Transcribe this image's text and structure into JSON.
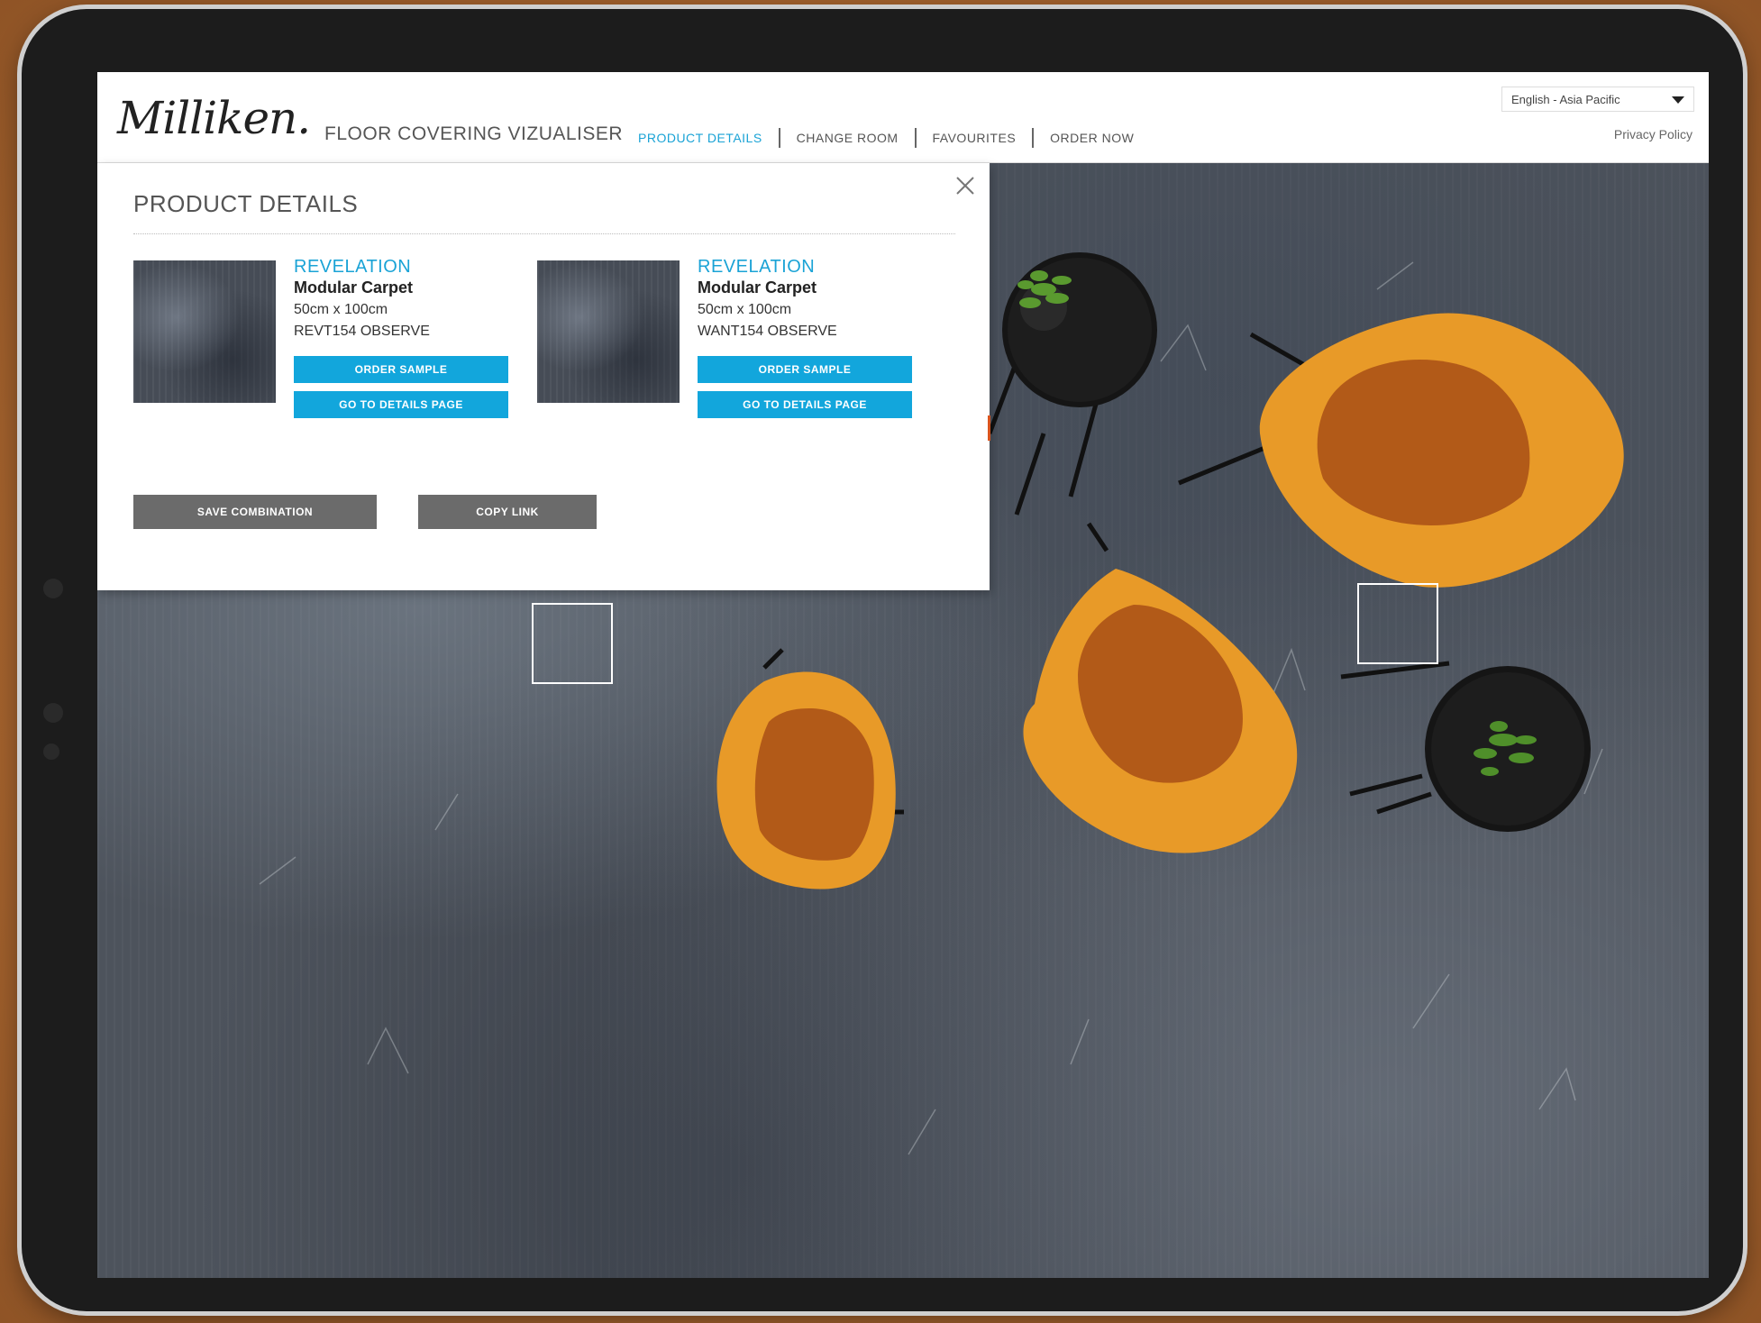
{
  "header": {
    "logo_text": "Milliken.",
    "app_title": "FLOOR COVERING VIZUALISER",
    "nav": [
      "PRODUCT DETAILS",
      "CHANGE ROOM",
      "FAVOURITES",
      "ORDER NOW"
    ],
    "active_nav": "PRODUCT DETAILS",
    "language": "English - Asia Pacific",
    "privacy": "Privacy Policy"
  },
  "panel": {
    "title": "PRODUCT DETAILS",
    "products": [
      {
        "brand": "REVELATION",
        "type": "Modular Carpet",
        "size": "50cm x 100cm",
        "code": "REVT154 OBSERVE",
        "order_label": "ORDER SAMPLE",
        "details_label": "GO TO DETAILS PAGE"
      },
      {
        "brand": "REVELATION",
        "type": "Modular Carpet",
        "size": "50cm x 100cm",
        "code": "WANT154 OBSERVE",
        "order_label": "ORDER SAMPLE",
        "details_label": "GO TO DETAILS PAGE"
      }
    ],
    "save_label": "SAVE COMBINATION",
    "copy_label": "COPY LINK"
  },
  "colors": {
    "accent": "#1aa3d6",
    "button_blue": "#12a6dc",
    "button_gray": "#6b6b6b",
    "chair": "#e89a28",
    "chair_seat": "#b25a18",
    "table": "#111111",
    "floor": "#4d535c"
  },
  "icons": [
    "close-icon",
    "dropdown-caret-icon"
  ]
}
